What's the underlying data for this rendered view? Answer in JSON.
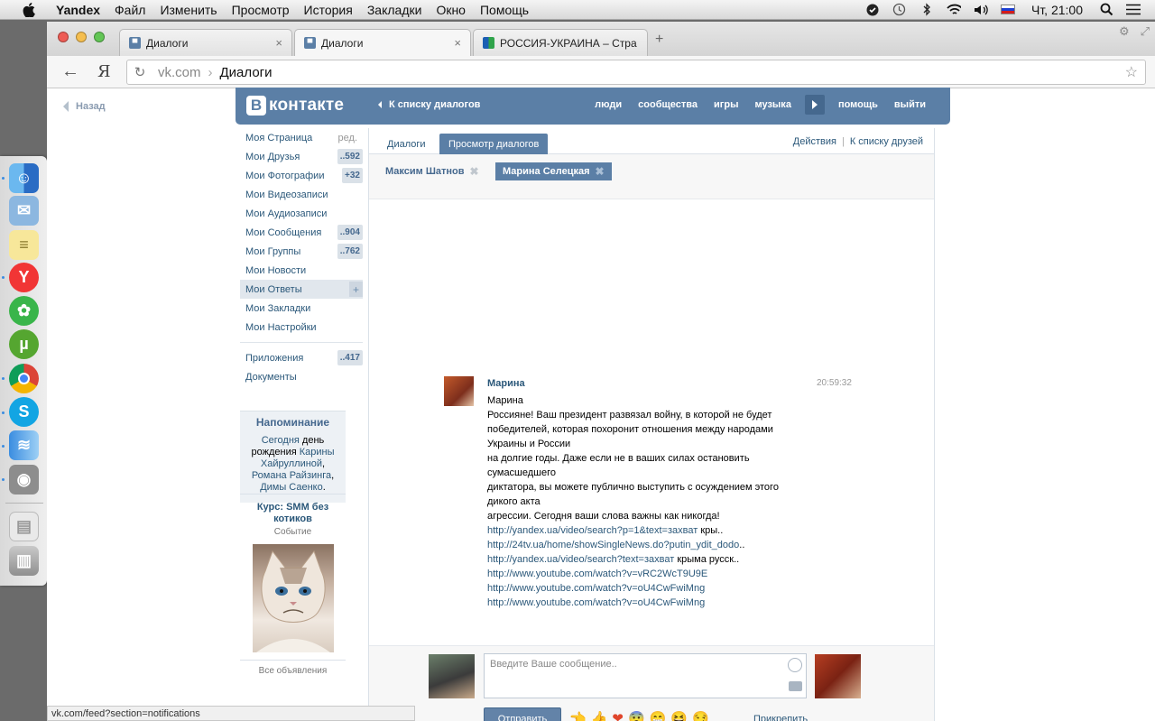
{
  "os_menubar": {
    "app_name": "Yandex",
    "menus": [
      "Файл",
      "Изменить",
      "Просмотр",
      "История",
      "Закладки",
      "Окно",
      "Помощь"
    ],
    "clock": "Чт, 21:00",
    "tray_icons": [
      "nuke-icon",
      "time-machine-icon",
      "bluetooth-icon",
      "wifi-icon",
      "volume-icon",
      "russia-flag-icon",
      "search-icon",
      "list-icon"
    ]
  },
  "browser": {
    "tabs": [
      {
        "label": "Диалоги",
        "active": false
      },
      {
        "label": "Диалоги",
        "active": true
      },
      {
        "label": "РОССИЯ-УКРАИНА – Стра",
        "active": false
      }
    ],
    "new_tab_symbol": "+",
    "back_symbol": "←",
    "yandex_button": "Я",
    "url_domain": "vk.com",
    "url_separator": "›",
    "url_path": "Диалоги",
    "status_url": "vk.com/feed?section=notifications"
  },
  "vk": {
    "back_label": "Назад",
    "logo_letter": "В",
    "logo_text": "контакте",
    "to_dialogs_list": "К списку диалогов",
    "top_nav": [
      "люди",
      "сообщества",
      "игры",
      "музыка",
      "помощь",
      "выйти"
    ],
    "left_menu": [
      {
        "label": "Моя Страница",
        "extra": "ред."
      },
      {
        "label": "Мои Друзья",
        "count": "..592"
      },
      {
        "label": "Мои Фотографии",
        "count": "+32"
      },
      {
        "label": "Мои Видеозаписи"
      },
      {
        "label": "Мои Аудиозаписи"
      },
      {
        "label": "Мои Сообщения",
        "count": "..904"
      },
      {
        "label": "Мои Группы",
        "count": "..762"
      },
      {
        "label": "Мои Новости"
      },
      {
        "label": "Мои Ответы",
        "plus": "+"
      },
      {
        "label": "Мои Закладки"
      },
      {
        "label": "Мои Настройки"
      }
    ],
    "left_menu_extra": [
      {
        "label": "Приложения",
        "count": "..417"
      },
      {
        "label": "Документы"
      }
    ],
    "reminder": {
      "title": "Напоминание",
      "link1": "Сегодня",
      "text1": " день рождения ",
      "link2": "Карины Хайруллиной",
      "comma1": ", ",
      "link3": "Романа Райзинга",
      "comma2": ", ",
      "link4": "Димы Саенко",
      "dot": "."
    },
    "ad": {
      "title": "Курс: SMM без котиков",
      "subtitle": "Событие",
      "all_ads": "Все объявления"
    },
    "dialog_tabs": [
      "Диалоги",
      "Просмотр диалогов"
    ],
    "actions": "Действия",
    "friends_link": "К списку друзей",
    "actions_sep": "|",
    "participants": [
      {
        "name": "Максим Шатнов",
        "selected": false
      },
      {
        "name": "Марина Селецкая",
        "selected": true
      }
    ],
    "chip_close_symbol": "✖",
    "message": {
      "author": "Марина",
      "time": "20:59:32",
      "lines": [
        "Марина",
        "Россияне! Ваш президент развязал войну, в которой не будет победителей, которая похоронит отношения между народами Украины и России",
        "на долгие годы. Даже если не в ваших силах остановить сумасшедшего",
        "диктатора, вы можете публично выступить с осуждением этого дикого акта",
        "агрессии. Сегодня ваши слова важны как никогда!"
      ],
      "links": [
        {
          "url": "http://yandex.ua/video/search?p=1&text=захват",
          "tail": " кры.."
        },
        {
          "url": "http://24tv.ua/home/showSingleNews.do?putin_ydit_dodo",
          "tail": ".."
        },
        {
          "url": "http://yandex.ua/video/search?text=захват",
          "tail": " крыма русск.."
        },
        {
          "url": "http://www.youtube.com/watch?v=vRC2WcT9U9E",
          "tail": ""
        },
        {
          "url": "http://www.youtube.com/watch?v=oU4CwFwiMng",
          "tail": ""
        },
        {
          "url": "http://www.youtube.com/watch?v=oU4CwFwiMng",
          "tail": ""
        }
      ]
    },
    "composer": {
      "placeholder": "Введите Ваше сообщение..",
      "send_label": "Отправить",
      "attach_label": "Прикрепить",
      "emojis": [
        "👈",
        "👍",
        "❤",
        "😨",
        "😁",
        "😆",
        "😏"
      ]
    }
  },
  "dock_apps": [
    "finder-icon",
    "mail-icon",
    "stickies-icon",
    "yandex-browser-icon",
    "icq-icon",
    "utorrent-icon",
    "chrome-icon",
    "skype-icon",
    "fish-icon",
    "image-capture-icon",
    "documents-icon",
    "trash-icon"
  ]
}
